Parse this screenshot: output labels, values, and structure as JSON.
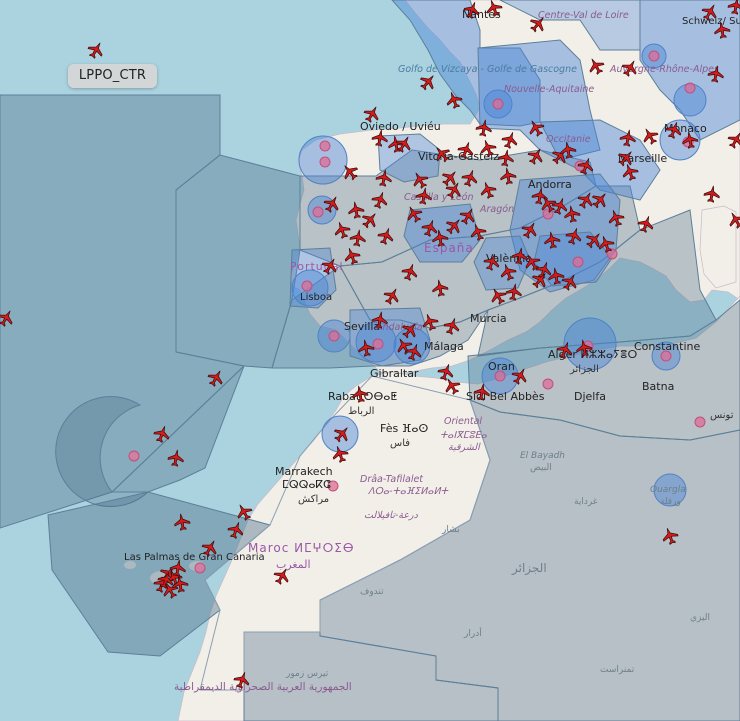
{
  "tooltip": {
    "label": "LPPO_CTR"
  },
  "colors": {
    "water": "#aad3df",
    "land": "#f2efe9",
    "sector_fill": "#4c6d88",
    "control_fill": "#4a86d8",
    "aircraft": "#d41c1c"
  },
  "icons": {
    "aircraft": "aircraft-icon",
    "airport": "airport-marker-icon"
  },
  "places": [
    {
      "id": "nantes",
      "name": "Nantes"
    },
    {
      "id": "centre",
      "name": "Centre-Val de Loire"
    },
    {
      "id": "suisse",
      "name": "Schweiz/ Suisse/Svizzera"
    },
    {
      "id": "golfe",
      "name": "Golfo de Vizcaya - Golfe de Gascogne"
    },
    {
      "id": "auvergne",
      "name": "Auvergne-Rhône-Alpes"
    },
    {
      "id": "nouvelle",
      "name": "Nouvelle-Aquitaine"
    },
    {
      "id": "monaco",
      "name": "Monaco"
    },
    {
      "id": "oviedo",
      "name": "Oviedo / Uviéu"
    },
    {
      "id": "vitoria",
      "name": "Vitoria-Gasteiz"
    },
    {
      "id": "occitanie",
      "name": "Occitanie"
    },
    {
      "id": "marseille",
      "name": "Marseille"
    },
    {
      "id": "andorra",
      "name": "Andorra"
    },
    {
      "id": "castilla",
      "name": "Castilla y León"
    },
    {
      "id": "aragon",
      "name": "Aragón"
    },
    {
      "id": "espana",
      "name": "España"
    },
    {
      "id": "valencia",
      "name": "València"
    },
    {
      "id": "portugal",
      "name": "Portugal"
    },
    {
      "id": "lisboa",
      "name": "Lisboa"
    },
    {
      "id": "murcia",
      "name": "Murcia"
    },
    {
      "id": "sevilla",
      "name": "Sevilla"
    },
    {
      "id": "andalucia",
      "name": "Andalucía"
    },
    {
      "id": "malaga",
      "name": "Málaga"
    },
    {
      "id": "gibraltar",
      "name": "Gibraltar"
    },
    {
      "id": "oran",
      "name": "Oran"
    },
    {
      "id": "alger",
      "name": "Alger ⵍⵣⵣⴰⵢⴻⵔ"
    },
    {
      "id": "aljazair_city",
      "name": "الجزائر"
    },
    {
      "id": "constantine",
      "name": "Constantine"
    },
    {
      "id": "batna",
      "name": "Batna"
    },
    {
      "id": "rabat",
      "name": "Rabat ⵔⴱⴰⵟ"
    },
    {
      "id": "rabat_ar",
      "name": "الرباط"
    },
    {
      "id": "sidi",
      "name": "Sidi Bel Abbès"
    },
    {
      "id": "djelfa",
      "name": "Djelfa"
    },
    {
      "id": "tunis",
      "name": "تونس"
    },
    {
      "id": "fes",
      "name": "Fès ⴼⴰⵙ"
    },
    {
      "id": "fes_ar",
      "name": "فاس"
    },
    {
      "id": "oriental",
      "name": "Oriental"
    },
    {
      "id": "oriental_tif",
      "name": "ⵜⴰⵏⴳⵎⵓⴹⴰ"
    },
    {
      "id": "oriental_ar",
      "name": "الشرقية"
    },
    {
      "id": "elbayadh",
      "name": "El Bayadh"
    },
    {
      "id": "elbayadh_ar",
      "name": "البيض"
    },
    {
      "id": "ghardaia",
      "name": "غرداية"
    },
    {
      "id": "ouargla",
      "name": "Ouargla"
    },
    {
      "id": "ouargla_ar",
      "name": "ورقلة"
    },
    {
      "id": "marrakech",
      "name": "Marrakech"
    },
    {
      "id": "marrakech_tif",
      "name": "ⵎⵕⵕⴰⴽⵛ"
    },
    {
      "id": "marrakech_ar",
      "name": "مراكش"
    },
    {
      "id": "draa",
      "name": "Drâa-Tafilalet"
    },
    {
      "id": "draa_tif",
      "name": "ⴷⵔⴰ-ⵜⴰⴼⵉⵍⴰⵍⵜ"
    },
    {
      "id": "draa_ar",
      "name": "درعة-تافيلالت"
    },
    {
      "id": "bechar",
      "name": "بشار"
    },
    {
      "id": "maroc",
      "name": "Maroc ⵍⵎⵖⵔⵉⴱ"
    },
    {
      "id": "maroc_ar",
      "name": "المغرب"
    },
    {
      "id": "aljazair",
      "name": "الجزائر"
    },
    {
      "id": "tindouf",
      "name": "تندوف"
    },
    {
      "id": "adrar",
      "name": "أدرار"
    },
    {
      "id": "illizi",
      "name": "اليزي"
    },
    {
      "id": "tamanrasset",
      "name": "تمنراست"
    },
    {
      "id": "tiris",
      "name": "تيرس زمور"
    },
    {
      "id": "laspalmas",
      "name": "Las Palmas de Gran Canaria"
    },
    {
      "id": "sahrawi",
      "name": "الجمهورية العربية الصحراوية الديمقراطية"
    }
  ]
}
